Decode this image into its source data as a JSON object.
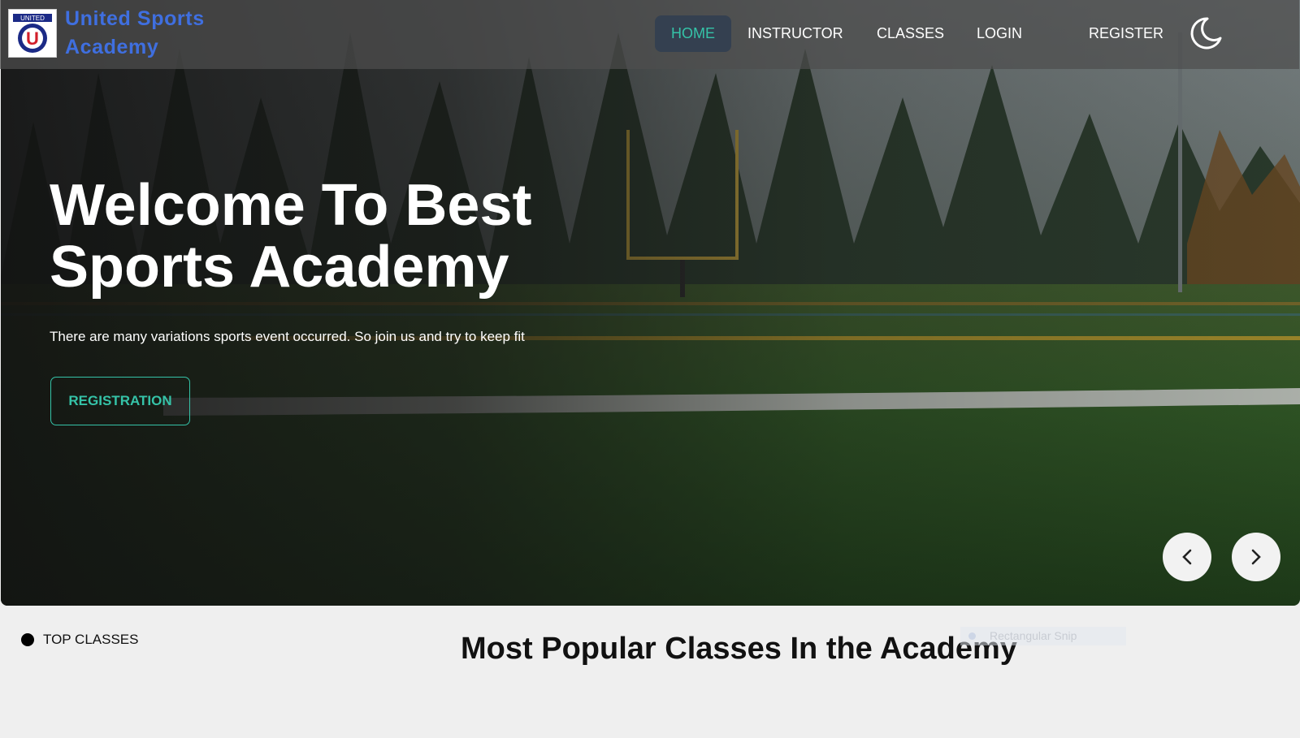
{
  "brand": {
    "name_line1": "United Sports",
    "name_line2": "Academy",
    "logo_text": "UNITED",
    "logo_letter": "U"
  },
  "nav": {
    "items": [
      {
        "label": "HOME",
        "active": true
      },
      {
        "label": "INSTRUCTOR",
        "active": false
      },
      {
        "label": "CLASSES",
        "active": false
      },
      {
        "label": "LOGIN",
        "active": false
      },
      {
        "label": "REGISTER",
        "active": false
      }
    ],
    "theme_icon": "moon-icon"
  },
  "hero": {
    "title_line1": "Welcome To Best",
    "title_line2": "Sports Academy",
    "subtitle": "There are many variations sports event occurred. So join us and try to keep fit",
    "cta_label": "REGISTRATION",
    "prev_icon": "chevron-left-icon",
    "next_icon": "chevron-right-icon"
  },
  "section": {
    "tag": "TOP CLASSES",
    "title": "Most Popular Classes In the Academy",
    "ghost_label": "Rectangular Snip"
  },
  "colors": {
    "accent": "#35c3a8",
    "brand": "#3f6fe0",
    "nav_active_bg": "#344050"
  }
}
